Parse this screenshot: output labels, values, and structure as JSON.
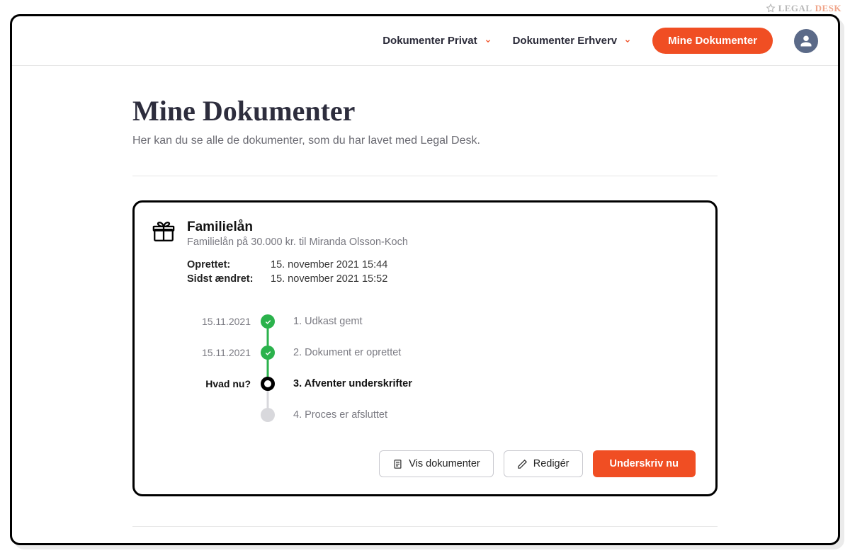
{
  "watermark": {
    "part1": "LEGAL",
    "part2": "DESK"
  },
  "header": {
    "nav1": "Dokumenter Privat",
    "nav2": "Dokumenter Erhverv",
    "cta": "Mine Dokumenter"
  },
  "page": {
    "title": "Mine Dokumenter",
    "subtitle": "Her kan du se alle de dokumenter, som du har lavet med Legal Desk."
  },
  "document": {
    "title": "Familielån",
    "subtitle": "Familielån på 30.000 kr. til Miranda Olsson-Koch",
    "meta": {
      "created_label": "Oprettet:",
      "created_value": "15. november 2021 15:44",
      "modified_label": "Sidst ændret:",
      "modified_value": "15. november 2021 15:52"
    },
    "timeline": [
      {
        "date": "15.11.2021",
        "label": "1.  Udkast gemt",
        "state": "done"
      },
      {
        "date": "15.11.2021",
        "label": "2.  Dokument er oprettet",
        "state": "done"
      },
      {
        "date": "Hvad nu?",
        "label": "3.  Afventer underskrifter",
        "state": "current"
      },
      {
        "date": "",
        "label": "4.  Proces er afsluttet",
        "state": "pending"
      }
    ],
    "actions": {
      "view": "Vis dokumenter",
      "edit": "Redigér",
      "sign": "Underskriv nu"
    }
  },
  "colors": {
    "accent": "#f04e23",
    "success": "#2bb24c"
  }
}
